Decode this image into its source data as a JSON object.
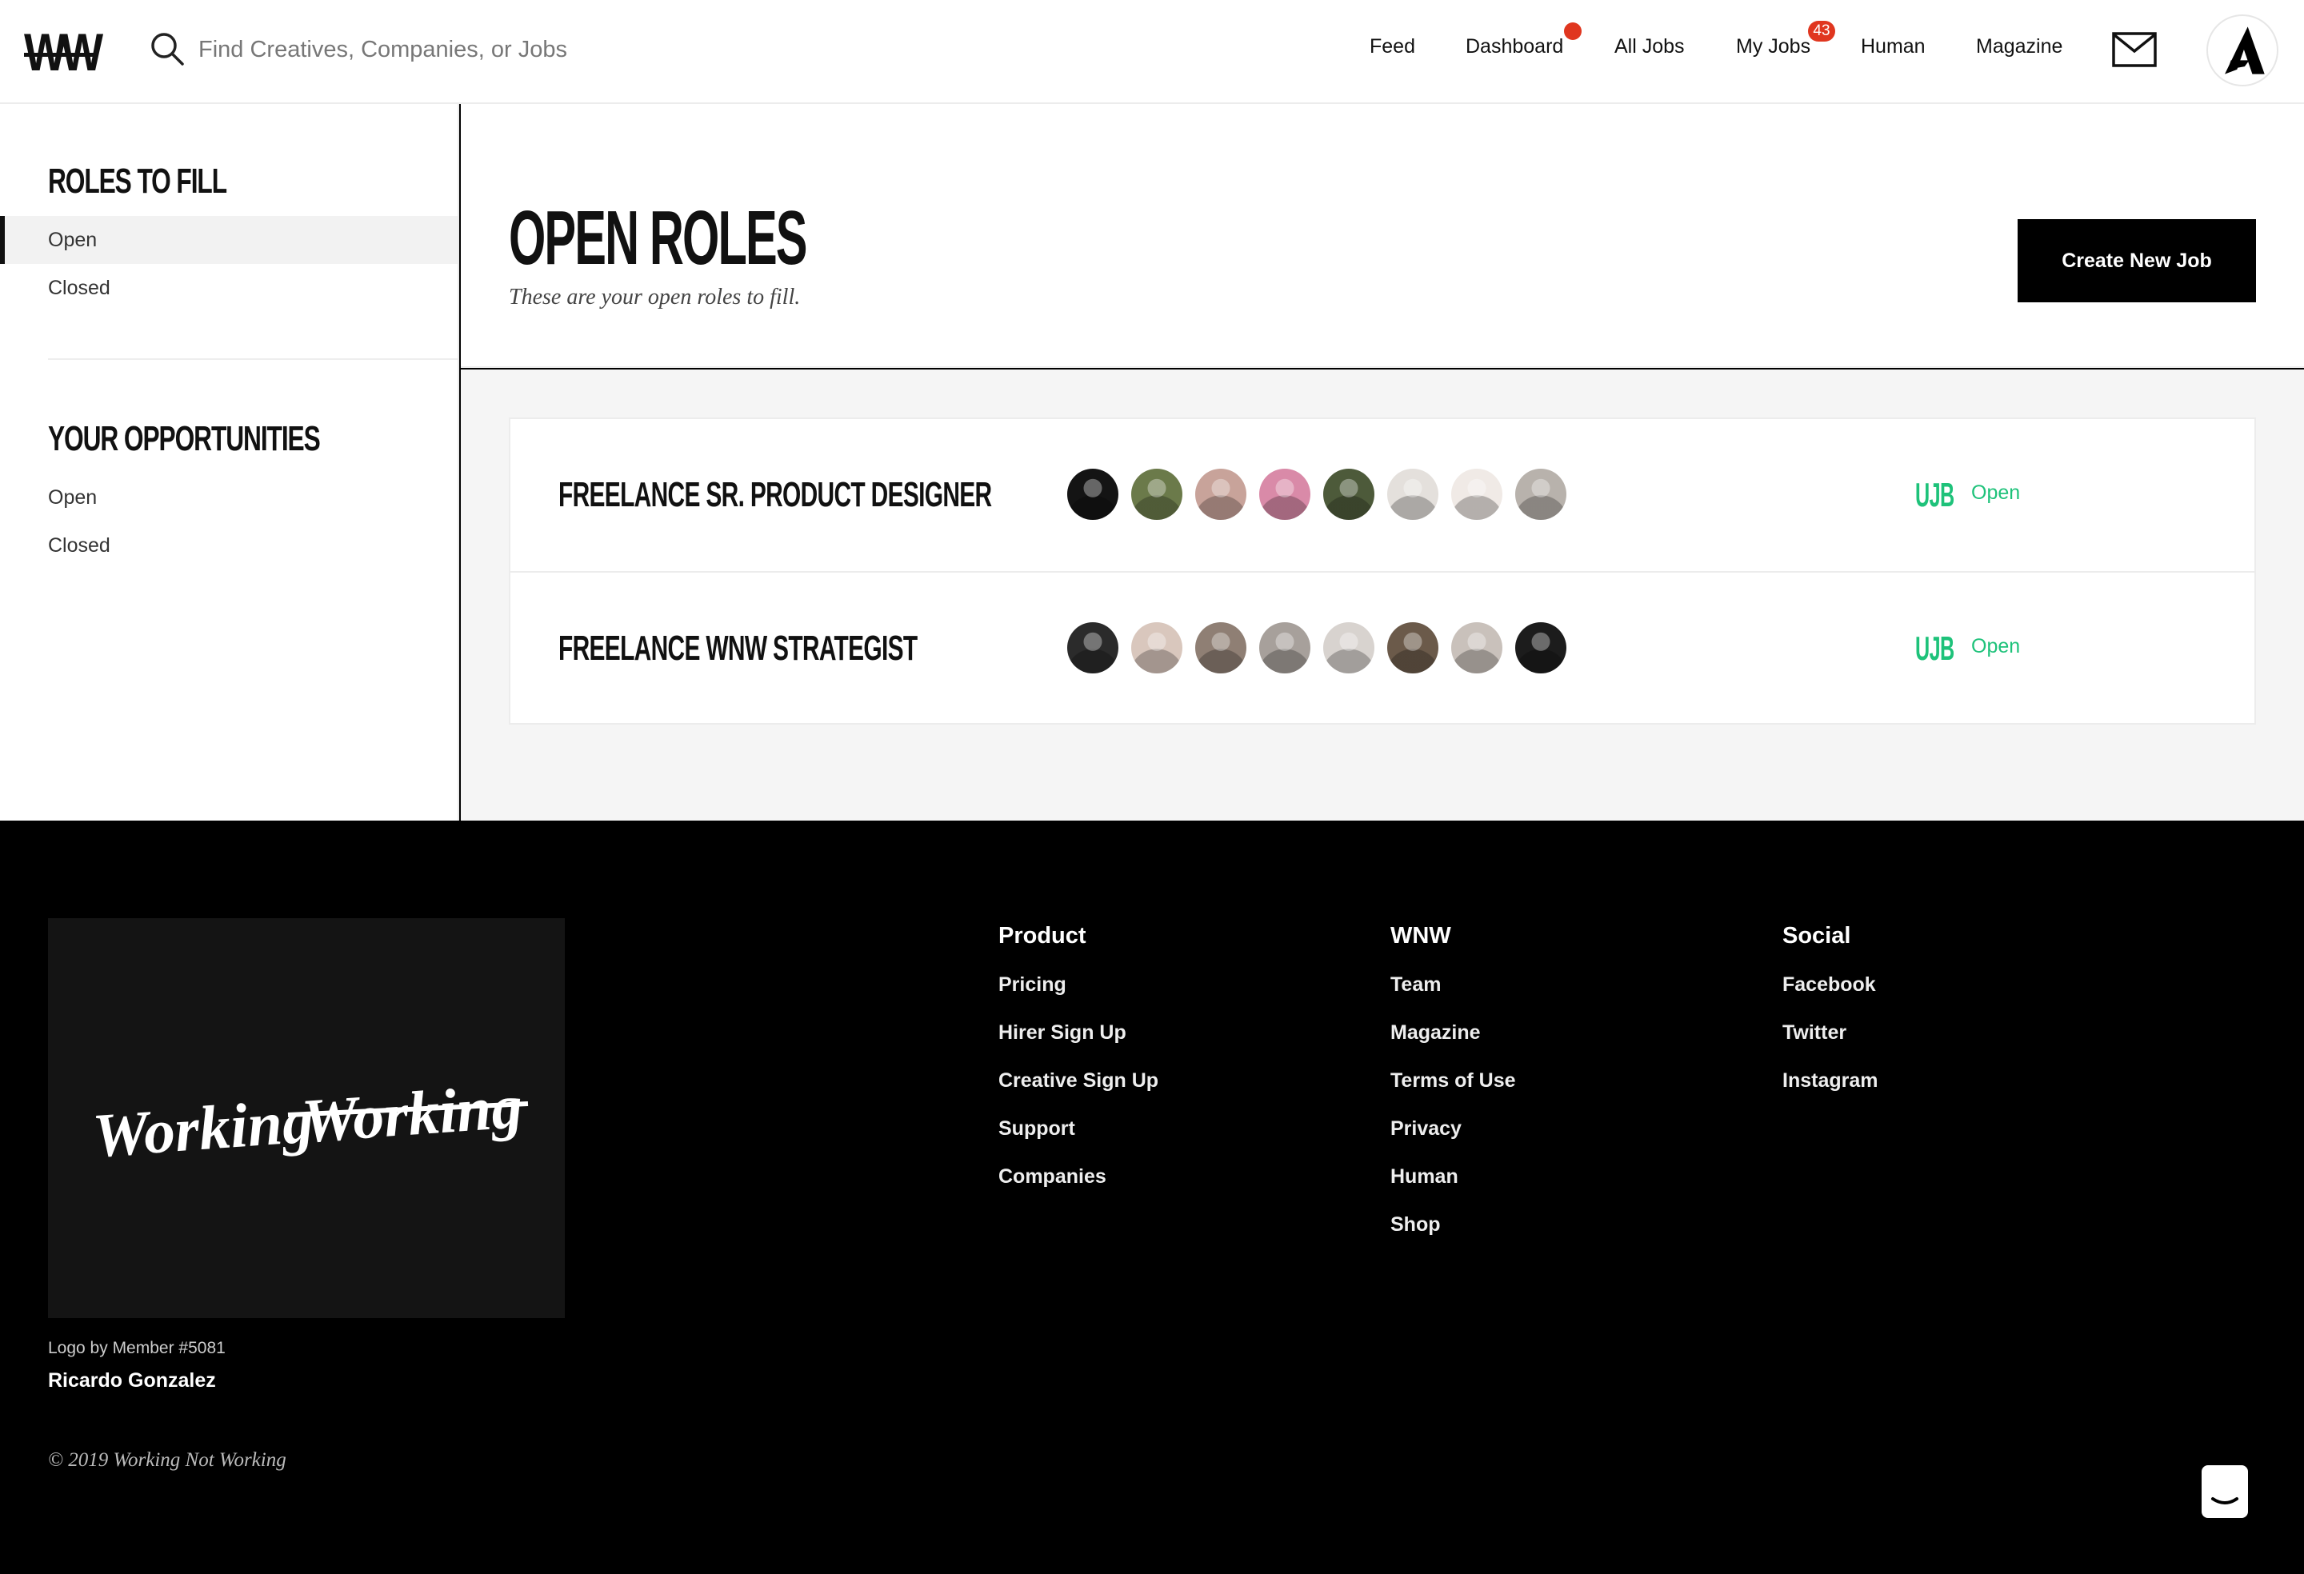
{
  "header": {
    "logo_text": "WW",
    "search_placeholder": "Find Creatives, Companies, or Jobs",
    "nav": [
      {
        "label": "Feed"
      },
      {
        "label": "Dashboard",
        "has_dot": true
      },
      {
        "label": "All Jobs"
      },
      {
        "label": "My Jobs",
        "badge": "43"
      },
      {
        "label": "Human"
      },
      {
        "label": "Magazine"
      }
    ],
    "mail_icon": "envelope-icon",
    "avatar_icon": "brand-a-logo"
  },
  "sidebar": {
    "roles_heading": "ROLES TO FILL",
    "roles_items": [
      "Open",
      "Closed"
    ],
    "roles_active": "Open",
    "opps_heading": "YOUR OPPORTUNITIES",
    "opps_items": [
      "Open",
      "Closed"
    ]
  },
  "main": {
    "title": "OPEN ROLES",
    "subtitle": "These are your open roles to fill.",
    "create_button": "Create New Job",
    "jobs": [
      {
        "title": "FREELANCE SR. PRODUCT DESIGNER",
        "badge": "UJB",
        "status": "Open",
        "avatar_colors": [
          "#141414",
          "#6b7a4a",
          "#c8a39a",
          "#d98aa8",
          "#4d5a3a",
          "#e4e0dc",
          "#f0eae6",
          "#b8b2ac"
        ]
      },
      {
        "title": "FREELANCE WNW STRATEGIST",
        "badge": "UJB",
        "status": "Open",
        "avatar_colors": [
          "#2b2b2b",
          "#d9c7bd",
          "#8f7f74",
          "#a7a09b",
          "#d8d3cf",
          "#6b5a4a",
          "#c9c1bb",
          "#1c1c1c"
        ]
      }
    ],
    "status_color": "#1ec27a"
  },
  "footer": {
    "logo_script": "Working Working",
    "logo_credit": "Logo by Member #5081",
    "logo_author": "Ricardo Gonzalez",
    "copyright": "© 2019 Working Not Working",
    "columns": [
      {
        "heading": "Product",
        "links": [
          "Pricing",
          "Hirer Sign Up",
          "Creative Sign Up",
          "Support",
          "Companies"
        ]
      },
      {
        "heading": "WNW",
        "links": [
          "Team",
          "Magazine",
          "Terms of Use",
          "Privacy",
          "Human",
          "Shop"
        ]
      },
      {
        "heading": "Social",
        "links": [
          "Facebook",
          "Twitter",
          "Instagram"
        ]
      }
    ],
    "chat_icon": "chat-bubble-icon"
  }
}
